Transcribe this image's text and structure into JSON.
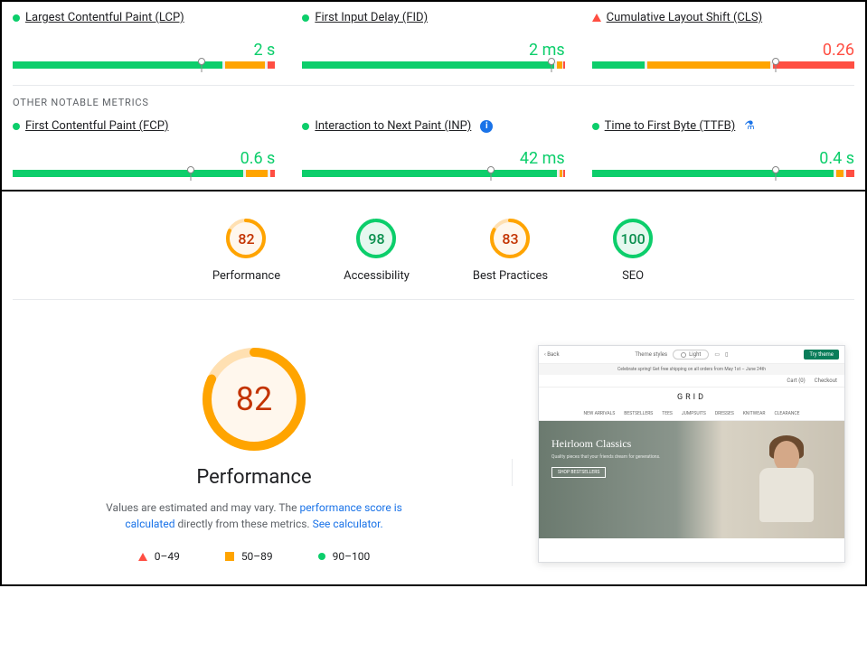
{
  "core_web_vitals": [
    {
      "label": "Largest Contentful Paint (LCP)",
      "value": "2 s",
      "status": "green",
      "marker_pct": 72,
      "segs": [
        [
          0,
          80,
          "g"
        ],
        [
          81,
          96,
          "o"
        ],
        [
          97,
          100,
          "r"
        ]
      ]
    },
    {
      "label": "First Input Delay (FID)",
      "value": "2 ms",
      "status": "green",
      "marker_pct": 95,
      "segs": [
        [
          0,
          96,
          "g"
        ],
        [
          97,
          99,
          "o"
        ],
        [
          99.5,
          100,
          "r"
        ]
      ]
    },
    {
      "label": "Cumulative Layout Shift (CLS)",
      "value": "0.26",
      "status": "red",
      "marker_pct": 70,
      "segs": [
        [
          0,
          20,
          "g"
        ],
        [
          21,
          68,
          "o"
        ],
        [
          69,
          100,
          "r"
        ]
      ]
    }
  ],
  "other_heading": "OTHER NOTABLE METRICS",
  "other_metrics": [
    {
      "label": "First Contentful Paint (FCP)",
      "value": "0.6 s",
      "status": "green",
      "icon": null,
      "marker_pct": 68,
      "segs": [
        [
          0,
          88,
          "g"
        ],
        [
          89,
          97,
          "o"
        ],
        [
          98,
          100,
          "r"
        ]
      ]
    },
    {
      "label": "Interaction to Next Paint (INP)",
      "value": "42 ms",
      "status": "green",
      "icon": "info",
      "marker_pct": 72,
      "segs": [
        [
          0,
          97,
          "g"
        ],
        [
          98,
          99,
          "o"
        ],
        [
          99.5,
          100,
          "r"
        ]
      ]
    },
    {
      "label": "Time to First Byte (TTFB)",
      "value": "0.4 s",
      "status": "green",
      "icon": "flask",
      "marker_pct": 70,
      "segs": [
        [
          0,
          92,
          "g"
        ],
        [
          93,
          96,
          "o"
        ],
        [
          97,
          100,
          "r"
        ]
      ]
    }
  ],
  "scores": [
    {
      "label": "Performance",
      "value": 82,
      "color": "orange"
    },
    {
      "label": "Accessibility",
      "value": 98,
      "color": "green"
    },
    {
      "label": "Best Practices",
      "value": 83,
      "color": "orange"
    },
    {
      "label": "SEO",
      "value": 100,
      "color": "green"
    }
  ],
  "performance": {
    "big_value": 82,
    "title": "Performance",
    "desc_prefix": "Values are estimated and may vary. The ",
    "desc_link1": "performance score is calculated",
    "desc_mid": " directly from these metrics. ",
    "desc_link2": "See calculator.",
    "legend": [
      {
        "range": "0–49",
        "shape": "tri-red"
      },
      {
        "range": "50–89",
        "shape": "sq-orange"
      },
      {
        "range": "90–100",
        "shape": "dot-green"
      }
    ]
  },
  "thumb": {
    "back": "Back",
    "theme_label": "Theme styles",
    "theme_value": "Light",
    "try_btn": "Try theme",
    "banner": "Celebrate spring! Get free shipping on all orders from May 1st – June 24th",
    "tab1": "Cart (0)",
    "tab2": "Checkout",
    "logo": "GRID",
    "nav": [
      "NEW ARRIVALS",
      "BESTSELLERS",
      "TEES",
      "JUMPSUITS",
      "DRESSES",
      "KNITWEAR",
      "CLEARANCE"
    ],
    "hero_title": "Heirloom Classics",
    "hero_sub": "Quality pieces that your friends dream for generations.",
    "hero_btn": "SHOP BESTSELLERS"
  }
}
